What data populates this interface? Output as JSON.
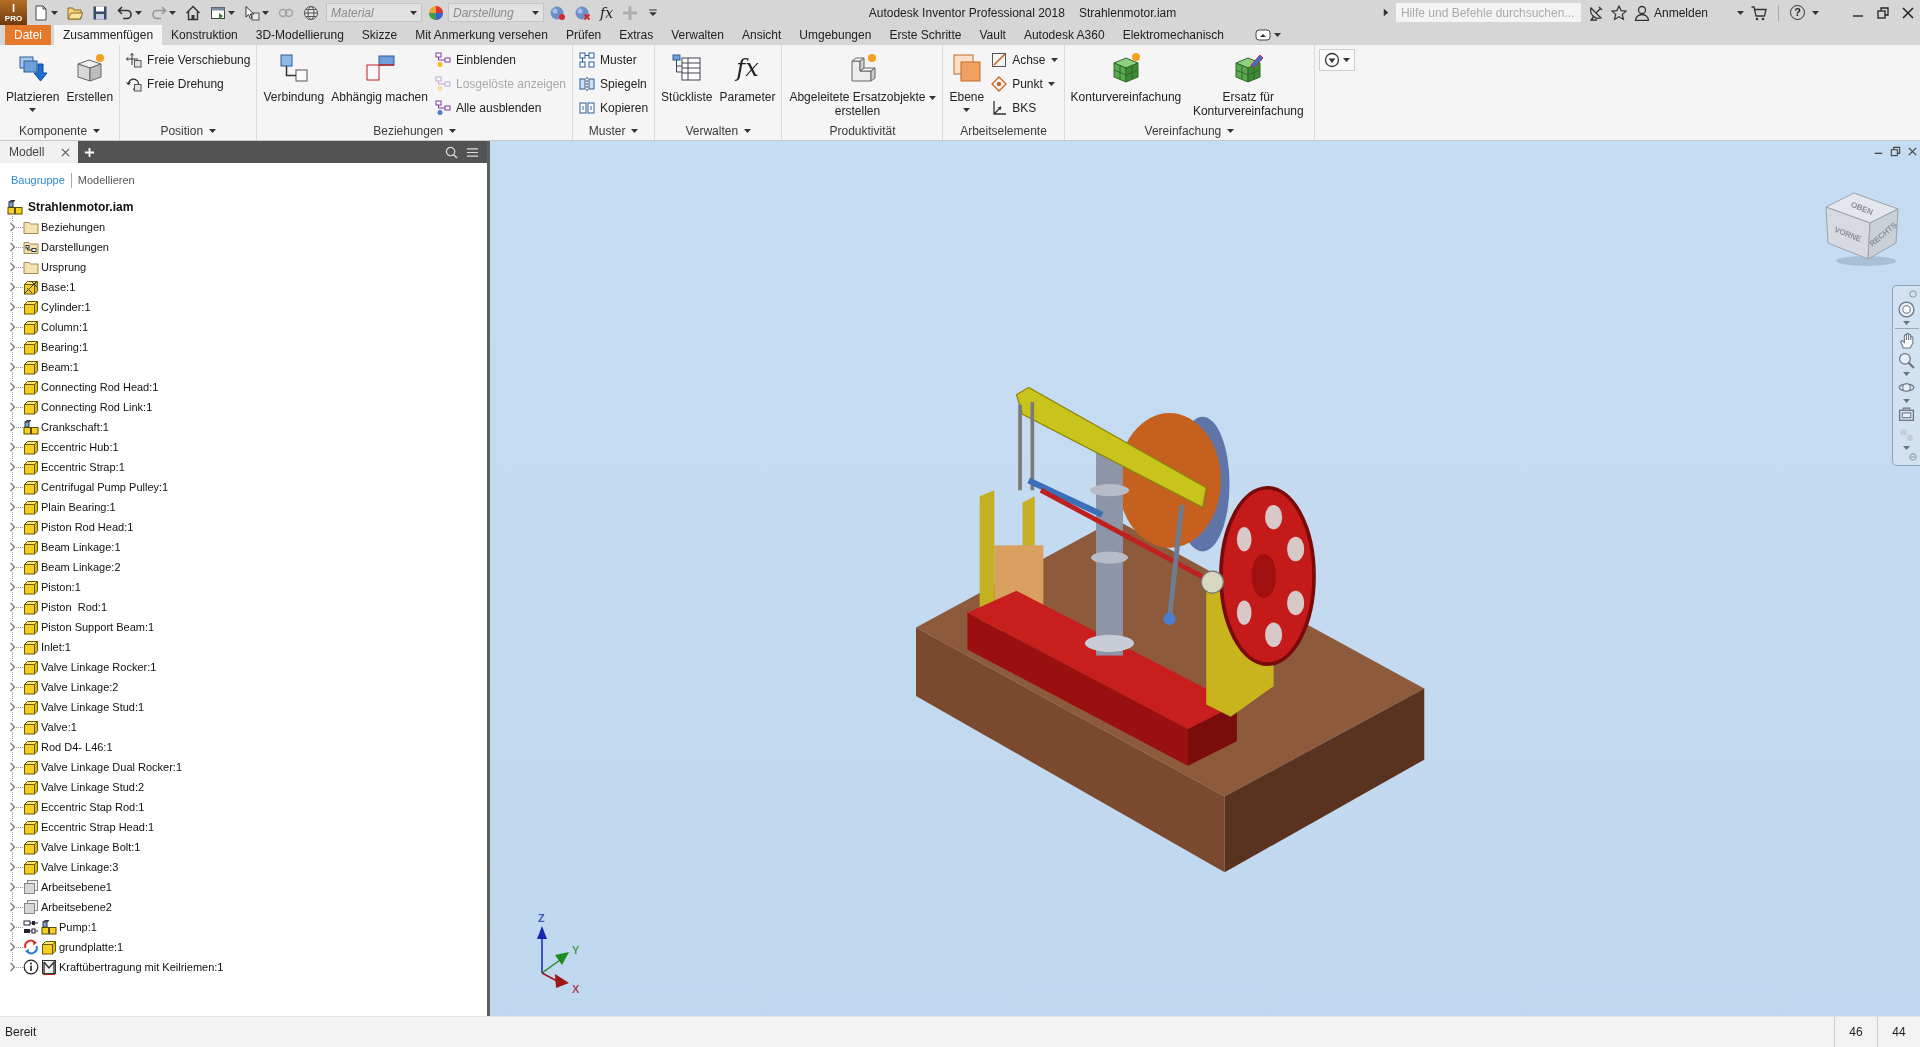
{
  "app": {
    "logo_letter": "I",
    "edition": "PRO",
    "title": "Autodesk Inventor Professional 2018",
    "document": "Strahlenmotor.iam"
  },
  "quick_access": [
    {
      "kind": "new",
      "menu": true,
      "disabled": false
    },
    {
      "kind": "open",
      "menu": false,
      "disabled": false
    },
    {
      "kind": "save",
      "menu": false,
      "disabled": false
    },
    {
      "kind": "undo",
      "menu": true,
      "disabled": false
    },
    {
      "kind": "redo",
      "menu": true,
      "disabled": true
    },
    {
      "kind": "home",
      "menu": false,
      "disabled": false
    },
    {
      "kind": "window",
      "menu": true,
      "disabled": false
    },
    {
      "kind": "select",
      "menu": true,
      "disabled": false
    },
    {
      "kind": "link",
      "menu": false,
      "disabled": true
    },
    {
      "kind": "globe",
      "menu": false,
      "disabled": false
    }
  ],
  "material_field": {
    "placeholder": "Material"
  },
  "appearance_field": {
    "placeholder": "Darstellung"
  },
  "quick_access_end": [
    {
      "kind": "sphere-dot",
      "disabled": false
    },
    {
      "kind": "sphere-cross",
      "disabled": false
    },
    {
      "kind": "function",
      "glyph": "fx",
      "disabled": false
    },
    {
      "kind": "move",
      "disabled": true
    },
    {
      "kind": "customize",
      "disabled": false
    }
  ],
  "help_bar": {
    "search": {
      "placeholder": "Hilfe und Befehle durchsuchen..."
    },
    "sign_in": "Anmelden",
    "help_glyph": "?"
  },
  "ribbon": {
    "tabs": [
      {
        "label": "Datei",
        "kind": "file",
        "selected": false
      },
      {
        "label": "Zusammenfügen",
        "kind": "tab",
        "selected": true
      },
      {
        "label": "Konstruktion",
        "kind": "tab",
        "selected": false
      },
      {
        "label": "3D-Modellierung",
        "kind": "tab",
        "selected": false
      },
      {
        "label": "Skizze",
        "kind": "tab",
        "selected": false
      },
      {
        "label": "Mit Anmerkung versehen",
        "kind": "tab",
        "selected": false
      },
      {
        "label": "Prüfen",
        "kind": "tab",
        "selected": false
      },
      {
        "label": "Extras",
        "kind": "tab",
        "selected": false
      },
      {
        "label": "Verwalten",
        "kind": "tab",
        "selected": false
      },
      {
        "label": "Ansicht",
        "kind": "tab",
        "selected": false
      },
      {
        "label": "Umgebungen",
        "kind": "tab",
        "selected": false
      },
      {
        "label": "Erste Schritte",
        "kind": "tab",
        "selected": false
      },
      {
        "label": "Vault",
        "kind": "tab",
        "selected": false
      },
      {
        "label": "Autodesk A360",
        "kind": "tab",
        "selected": false
      },
      {
        "label": "Elektromechanisch",
        "kind": "tab",
        "selected": false
      }
    ],
    "panels": [
      {
        "label": "Komponente",
        "has_menu": true,
        "tools": [
          {
            "label": "Platzieren",
            "kind": "large",
            "menu": true,
            "disabled": false
          },
          {
            "label": "Erstellen",
            "kind": "large",
            "menu": false,
            "disabled": false
          }
        ]
      },
      {
        "label": "Position",
        "has_menu": true,
        "tools": [
          {
            "label": "Freie Verschiebung",
            "kind": "small",
            "menu": false,
            "disabled": false
          },
          {
            "label": "Freie Drehung",
            "kind": "small",
            "menu": false,
            "disabled": false
          }
        ]
      },
      {
        "label": "Beziehungen",
        "has_menu": true,
        "tools": [
          {
            "label": "Verbindung",
            "kind": "large",
            "menu": false,
            "disabled": false
          },
          {
            "label": "Abhängig machen",
            "kind": "large",
            "menu": false,
            "disabled": false
          },
          {
            "label": "Einblenden",
            "kind": "small",
            "menu": false,
            "disabled": false
          },
          {
            "label": "Losgelöste anzeigen",
            "kind": "small",
            "menu": false,
            "disabled": true
          },
          {
            "label": "Alle ausblenden",
            "kind": "small",
            "menu": false,
            "disabled": false
          }
        ]
      },
      {
        "label": "Muster",
        "has_menu": true,
        "tools": [
          {
            "label": "Muster",
            "kind": "small",
            "menu": false,
            "disabled": false
          },
          {
            "label": "Spiegeln",
            "kind": "small",
            "menu": false,
            "disabled": false
          },
          {
            "label": "Kopieren",
            "kind": "small",
            "menu": false,
            "disabled": false
          }
        ]
      },
      {
        "label": "Verwalten",
        "has_menu": true,
        "tools": [
          {
            "label": "Stückliste",
            "kind": "large",
            "menu": false,
            "disabled": false
          },
          {
            "label": "Parameter",
            "kind": "large",
            "glyph": "fx",
            "menu": false,
            "disabled": false
          }
        ]
      },
      {
        "label": "Produktivität",
        "has_menu": false,
        "tools": [
          {
            "label": "Abgeleitete Ersatzobjekte erstellen",
            "kind": "large-wide",
            "menu": true,
            "disabled": false
          }
        ]
      },
      {
        "label": "Arbeitselemente",
        "has_menu": false,
        "tools": [
          {
            "label": "Ebene",
            "kind": "large",
            "menu": true,
            "disabled": false
          },
          {
            "label": "Achse",
            "kind": "small",
            "menu": true,
            "disabled": false
          },
          {
            "label": "Punkt",
            "kind": "small",
            "menu": true,
            "disabled": false
          },
          {
            "label": "BKS",
            "kind": "small",
            "menu": false,
            "disabled": false
          }
        ]
      },
      {
        "label": "Vereinfachung",
        "has_menu": true,
        "tools": [
          {
            "label": "Konturvereinfachung",
            "kind": "large",
            "menu": false,
            "disabled": false
          },
          {
            "label": "Ersatz für Konturvereinfachung",
            "kind": "large",
            "menu": false,
            "disabled": false
          }
        ]
      }
    ]
  },
  "browser": {
    "tabs": [
      {
        "label": "Modell",
        "selected": true
      }
    ],
    "modes": [
      {
        "label": "Baugruppe",
        "selected": true
      },
      {
        "label": "Modellieren",
        "selected": false
      }
    ],
    "tree": {
      "label": "Strahlenmotor.iam",
      "kind": "assembly",
      "children": [
        {
          "label": "Beziehungen",
          "kind": "folder",
          "expanded": false
        },
        {
          "label": "Darstellungen",
          "kind": "views",
          "expanded": false
        },
        {
          "label": "Ursprung",
          "kind": "folder",
          "expanded": false
        },
        {
          "label": "Base:1",
          "kind": "grounded",
          "expanded": false
        },
        {
          "label": "Cylinder:1",
          "kind": "part",
          "expanded": false
        },
        {
          "label": "Column:1",
          "kind": "part",
          "expanded": false
        },
        {
          "label": "Bearing:1",
          "kind": "part",
          "expanded": false
        },
        {
          "label": "Beam:1",
          "kind": "part",
          "expanded": false
        },
        {
          "label": "Connecting Rod Head:1",
          "kind": "part",
          "expanded": false
        },
        {
          "label": "Connecting Rod Link:1",
          "kind": "part",
          "expanded": false
        },
        {
          "label": "Crankschaft:1",
          "kind": "assembly",
          "expanded": false
        },
        {
          "label": "Eccentric Hub:1",
          "kind": "part",
          "expanded": false
        },
        {
          "label": "Eccentric Strap:1",
          "kind": "part",
          "expanded": false
        },
        {
          "label": "Centrifugal Pump Pulley:1",
          "kind": "part",
          "expanded": false
        },
        {
          "label": "Plain Bearing:1",
          "kind": "part",
          "expanded": false
        },
        {
          "label": "Piston Rod Head:1",
          "kind": "part",
          "expanded": false
        },
        {
          "label": "Beam Linkage:1",
          "kind": "part",
          "expanded": false
        },
        {
          "label": "Beam Linkage:2",
          "kind": "part",
          "expanded": false
        },
        {
          "label": "Piston:1",
          "kind": "part",
          "expanded": false
        },
        {
          "label": "Piston  Rod:1",
          "kind": "part",
          "expanded": false
        },
        {
          "label": "Piston Support Beam:1",
          "kind": "part",
          "expanded": false
        },
        {
          "label": "Inlet:1",
          "kind": "part",
          "expanded": false
        },
        {
          "label": "Valve Linkage Rocker:1",
          "kind": "part",
          "expanded": false
        },
        {
          "label": "Valve Linkage:2",
          "kind": "part",
          "expanded": false
        },
        {
          "label": "Valve Linkage Stud:1",
          "kind": "part",
          "expanded": false
        },
        {
          "label": "Valve:1",
          "kind": "part",
          "expanded": false
        },
        {
          "label": "Rod D4- L46:1",
          "kind": "part",
          "expanded": false
        },
        {
          "label": "Valve Linkage Dual Rocker:1",
          "kind": "part",
          "expanded": false
        },
        {
          "label": "Valve Linkage Stud:2",
          "kind": "part",
          "expanded": false
        },
        {
          "label": "Eccentric Stap Rod:1",
          "kind": "part",
          "expanded": false
        },
        {
          "label": "Eccentric Strap Head:1",
          "kind": "part",
          "expanded": false
        },
        {
          "label": "Valve Linkage Bolt:1",
          "kind": "part",
          "expanded": false
        },
        {
          "label": "Valve Linkage:3",
          "kind": "part",
          "expanded": false
        },
        {
          "label": "Arbeitsebene1",
          "kind": "plane",
          "expanded": false
        },
        {
          "label": "Arbeitsebene2",
          "kind": "plane",
          "expanded": false
        },
        {
          "label": "Pump:1",
          "kind": "generated-assembly",
          "expanded": false
        },
        {
          "label": "grundplatte:1",
          "kind": "outdated-part",
          "expanded": false
        },
        {
          "label": "Kraftübertragung mit Keilriemen:1",
          "kind": "accelerator",
          "expanded": false
        }
      ]
    }
  },
  "viewport": {
    "view_cube": {
      "top": "OBEN",
      "front": "VORNE",
      "right": "RECHTS"
    },
    "triad": [
      {
        "label": "Z",
        "color": "#1428b4"
      },
      {
        "label": "Y",
        "color": "#1e8c23"
      },
      {
        "label": "X",
        "color": "#a01414"
      }
    ]
  },
  "status_bar": {
    "message": "Bereit",
    "cells": [
      "46",
      "44"
    ]
  }
}
